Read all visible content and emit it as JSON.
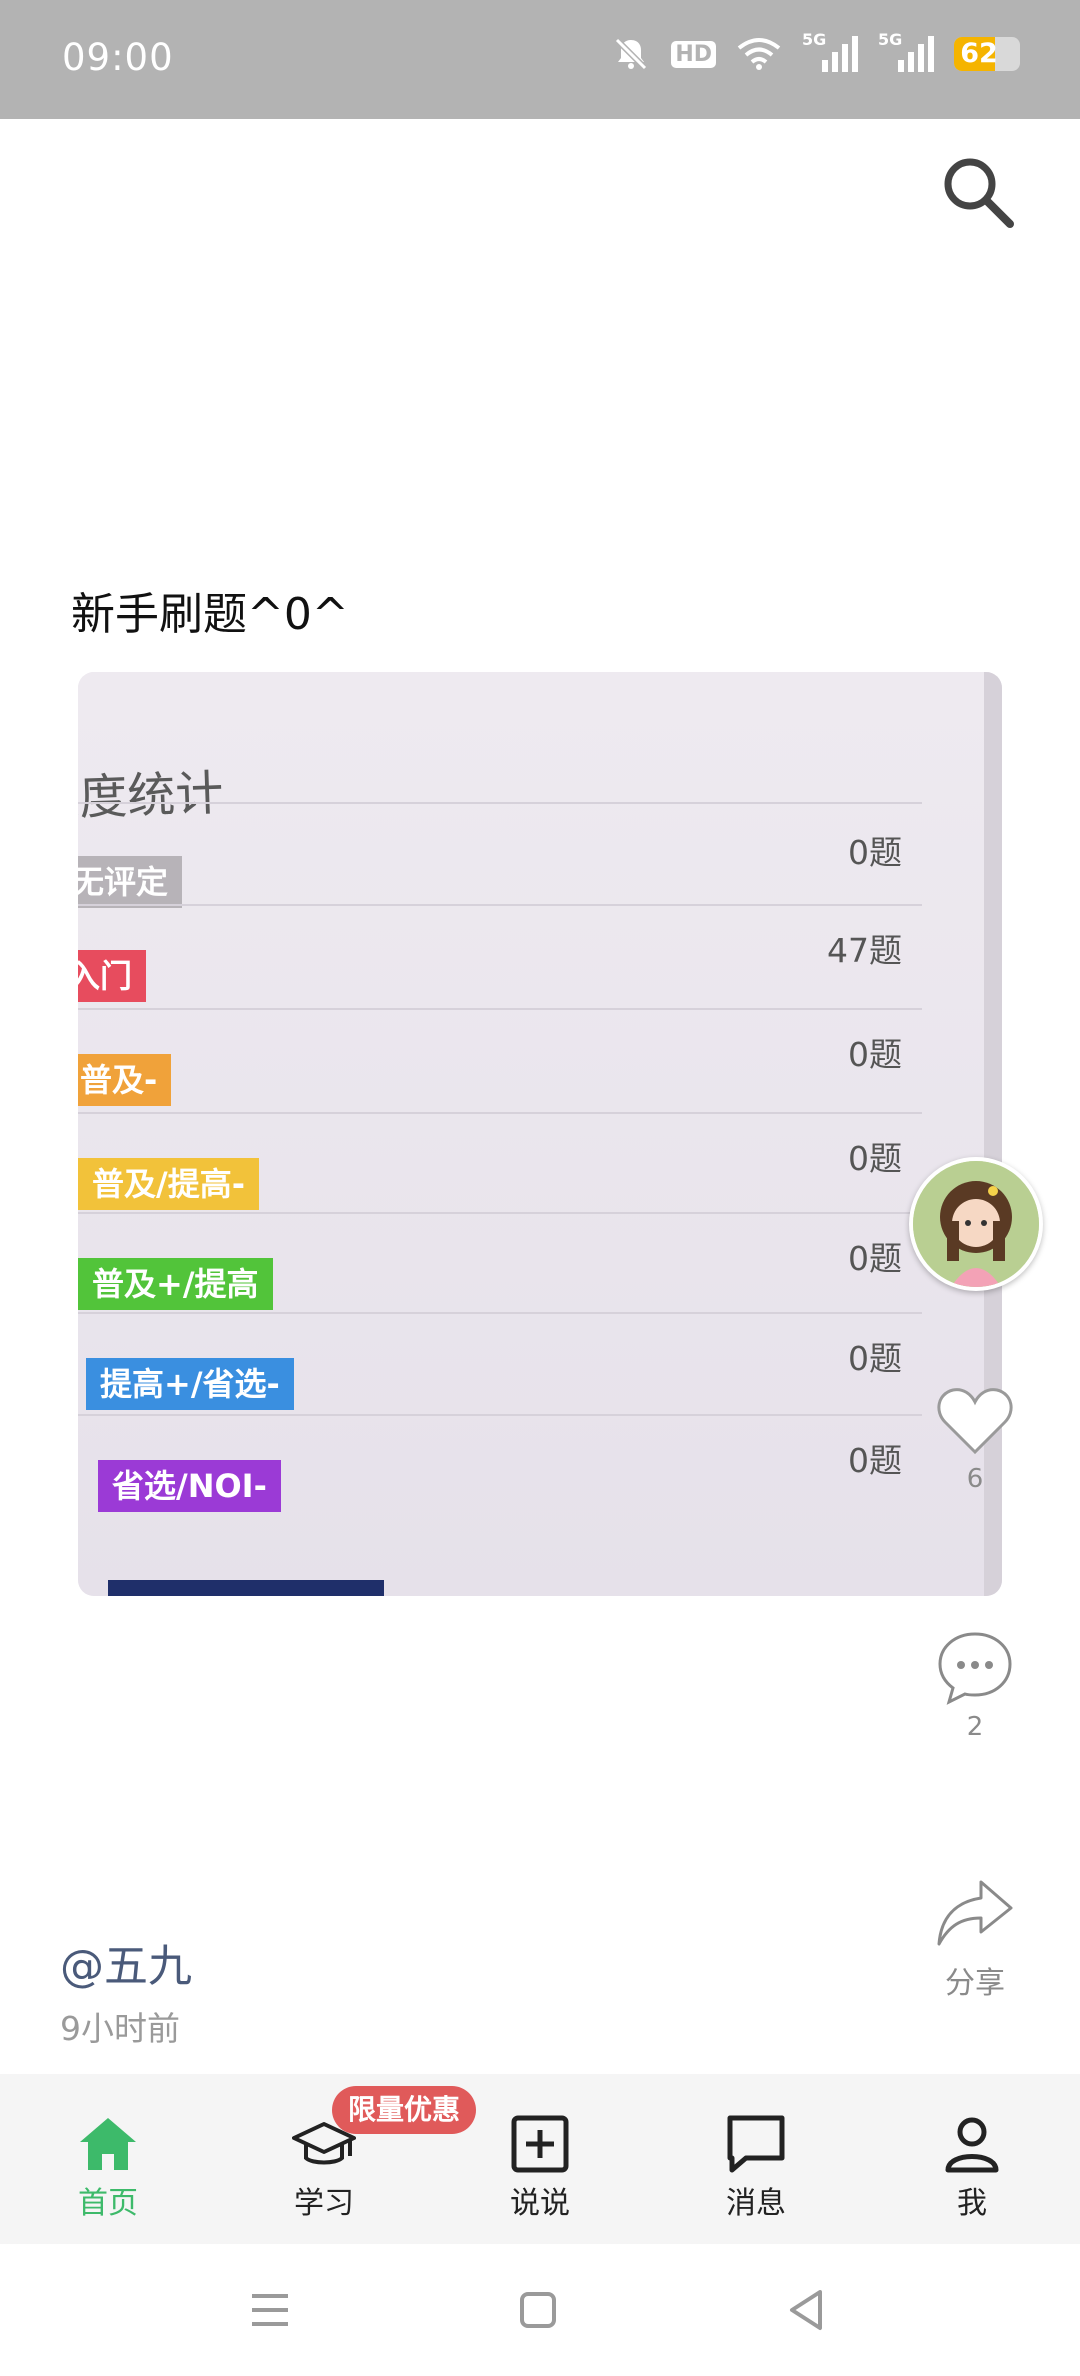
{
  "status_bar": {
    "time": "09:00",
    "hd_label": "HD",
    "signal_1_label": "5G",
    "signal_2_label": "5G",
    "battery_level": "62",
    "battery_fraction": 0.62
  },
  "header": {
    "search_icon": "search-icon"
  },
  "post": {
    "title": "新手刷题^0^",
    "image": {
      "heading": "题度统计",
      "rows": [
        {
          "tag": "无评定",
          "count": "0题",
          "color": "#b7b3b8"
        },
        {
          "tag": "入门",
          "count": "47题",
          "color": "#e74c5e"
        },
        {
          "tag": "普及-",
          "count": "0题",
          "color": "#f0a23a"
        },
        {
          "tag": "普及/提高-",
          "count": "0题",
          "color": "#f2c23a"
        },
        {
          "tag": "普及+/提高",
          "count": "0题",
          "color": "#52c43a"
        },
        {
          "tag": "提高+/省选-",
          "count": "0题",
          "color": "#3a8fe0"
        },
        {
          "tag": "省选/NOI-",
          "count": "0题",
          "color": "#9b3ad6"
        }
      ]
    },
    "author": "@五九",
    "time_ago": "9小时前"
  },
  "actions": {
    "like_count": "6",
    "comment_count": "2",
    "share_label": "分享"
  },
  "tabs": [
    {
      "label": "首页",
      "icon": "home-icon",
      "active": true
    },
    {
      "label": "学习",
      "icon": "graduation-cap-icon",
      "active": false
    },
    {
      "label": "说说",
      "icon": "plus-square-icon",
      "active": false
    },
    {
      "label": "消息",
      "icon": "chat-icon",
      "active": false
    },
    {
      "label": "我",
      "icon": "person-icon",
      "active": false
    }
  ],
  "promo_badge": "限量优惠",
  "colors": {
    "accent": "#3dba6a",
    "badge": "#e05a5a",
    "status_bar": "#b3b3b3"
  }
}
